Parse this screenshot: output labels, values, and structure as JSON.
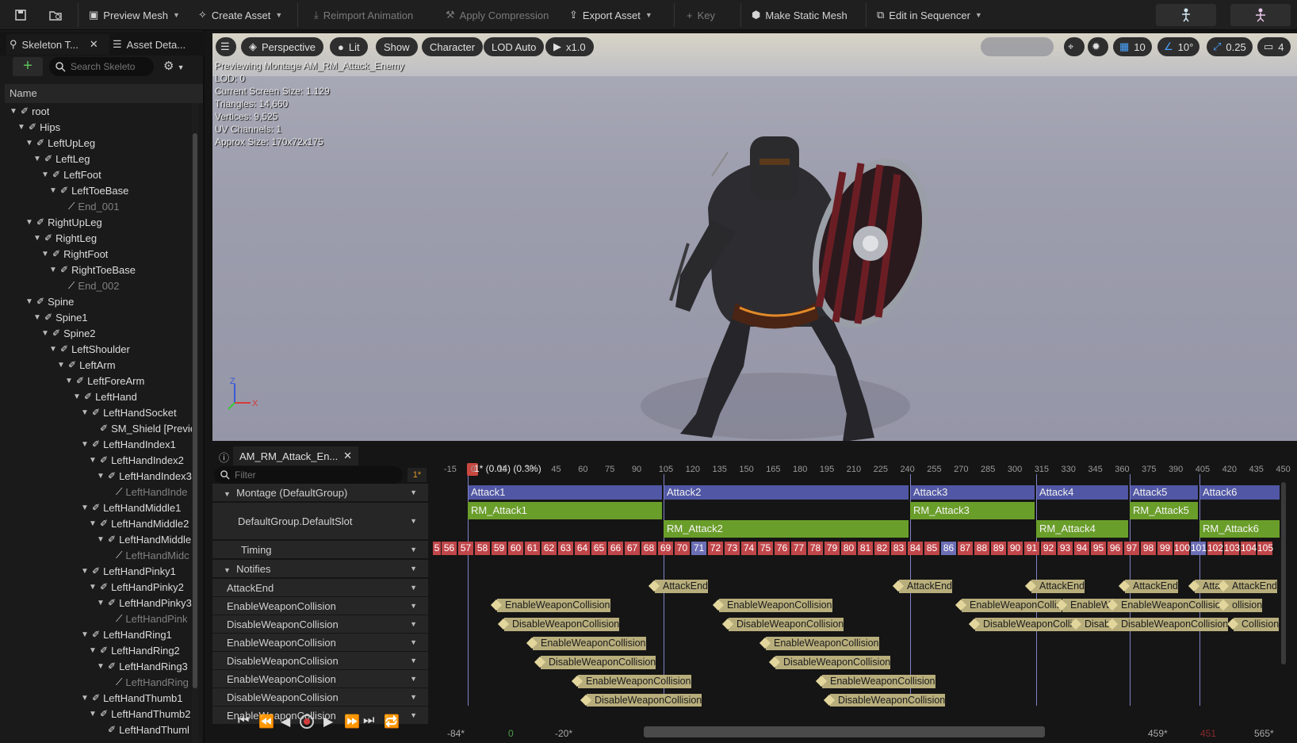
{
  "toolbar": {
    "preview_mesh": "Preview Mesh",
    "create_asset": "Create Asset",
    "reimport": "Reimport Animation",
    "apply_compression": "Apply Compression",
    "export_asset": "Export Asset",
    "key": "Key",
    "make_static_mesh": "Make Static Mesh",
    "edit_in_sequencer": "Edit in Sequencer"
  },
  "left": {
    "tab_skeleton": "Skeleton T...",
    "tab_details": "Asset Deta...",
    "search_placeholder": "Search Skeleto",
    "name_header": "Name",
    "bones": [
      {
        "label": "root",
        "depth": 0,
        "dim": false
      },
      {
        "label": "Hips",
        "depth": 1,
        "dim": false
      },
      {
        "label": "LeftUpLeg",
        "depth": 2,
        "dim": false
      },
      {
        "label": "LeftLeg",
        "depth": 3,
        "dim": false
      },
      {
        "label": "LeftFoot",
        "depth": 4,
        "dim": false
      },
      {
        "label": "LeftToeBase",
        "depth": 5,
        "dim": false
      },
      {
        "label": "End_001",
        "depth": 6,
        "dim": true
      },
      {
        "label": "RightUpLeg",
        "depth": 2,
        "dim": false
      },
      {
        "label": "RightLeg",
        "depth": 3,
        "dim": false
      },
      {
        "label": "RightFoot",
        "depth": 4,
        "dim": false
      },
      {
        "label": "RightToeBase",
        "depth": 5,
        "dim": false
      },
      {
        "label": "End_002",
        "depth": 6,
        "dim": true
      },
      {
        "label": "Spine",
        "depth": 2,
        "dim": false
      },
      {
        "label": "Spine1",
        "depth": 3,
        "dim": false
      },
      {
        "label": "Spine2",
        "depth": 4,
        "dim": false
      },
      {
        "label": "LeftShoulder",
        "depth": 5,
        "dim": false
      },
      {
        "label": "LeftArm",
        "depth": 6,
        "dim": false
      },
      {
        "label": "LeftForeArm",
        "depth": 7,
        "dim": false
      },
      {
        "label": "LeftHand",
        "depth": 8,
        "dim": false
      },
      {
        "label": "LeftHandSocket",
        "depth": 9,
        "dim": false
      },
      {
        "label": "SM_Shield [Previe",
        "depth": 10,
        "dim": false
      },
      {
        "label": "LeftHandIndex1",
        "depth": 9,
        "dim": false
      },
      {
        "label": "LeftHandIndex2",
        "depth": 10,
        "dim": false
      },
      {
        "label": "LeftHandIndex3",
        "depth": 11,
        "dim": false
      },
      {
        "label": "LeftHandInde",
        "depth": 12,
        "dim": true
      },
      {
        "label": "LeftHandMiddle1",
        "depth": 9,
        "dim": false
      },
      {
        "label": "LeftHandMiddle2",
        "depth": 10,
        "dim": false
      },
      {
        "label": "LeftHandMiddle",
        "depth": 11,
        "dim": false
      },
      {
        "label": "LeftHandMidc",
        "depth": 12,
        "dim": true
      },
      {
        "label": "LeftHandPinky1",
        "depth": 9,
        "dim": false
      },
      {
        "label": "LeftHandPinky2",
        "depth": 10,
        "dim": false
      },
      {
        "label": "LeftHandPinky3",
        "depth": 11,
        "dim": false
      },
      {
        "label": "LeftHandPink",
        "depth": 12,
        "dim": true
      },
      {
        "label": "LeftHandRing1",
        "depth": 9,
        "dim": false
      },
      {
        "label": "LeftHandRing2",
        "depth": 10,
        "dim": false
      },
      {
        "label": "LeftHandRing3",
        "depth": 11,
        "dim": false
      },
      {
        "label": "LeftHandRing",
        "depth": 12,
        "dim": true
      },
      {
        "label": "LeftHandThumb1",
        "depth": 9,
        "dim": false
      },
      {
        "label": "LeftHandThumb2",
        "depth": 10,
        "dim": false
      },
      {
        "label": "LeftHandThuml",
        "depth": 11,
        "dim": false
      }
    ]
  },
  "viewport": {
    "perspective": "Perspective",
    "lit": "Lit",
    "show": "Show",
    "character": "Character",
    "lod": "LOD Auto",
    "speed": "x1.0",
    "grid_snap": "10",
    "rot_snap": "10°",
    "scale_snap": "0.25",
    "cam_speed": "4",
    "stats": [
      "Previewing Montage AM_RM_Attack_Enemy",
      "LOD: 0",
      "Current Screen Size: 1.129",
      "Triangles: 14,660",
      "Vertices: 9,525",
      "UV Channels: 1",
      "Approx Size: 170x72x175"
    ]
  },
  "montage": {
    "tab_title": "AM_RM_Attack_En...",
    "filter_placeholder": "Filter",
    "filter_count": "1*",
    "playhead": "1* (0.04) (0.3%)",
    "montage_group": "Montage (DefaultGroup)",
    "slot": "DefaultGroup.DefaultSlot",
    "timing": "Timing",
    "notifies": "Notifies",
    "notify_tracks": [
      "AttackEnd",
      "EnableWeaponCollision",
      "DisableWeaponCollision",
      "EnableWeaponCollision",
      "DisableWeaponCollision",
      "EnableWeaponCollision",
      "DisableWeaponCollision",
      "EnableWeaponCollision"
    ],
    "ruler": [
      "-15",
      "0",
      "15",
      "30",
      "45",
      "60",
      "75",
      "90",
      "105",
      "120",
      "135",
      "150",
      "165",
      "180",
      "195",
      "210",
      "225",
      "240",
      "255",
      "270",
      "285",
      "300",
      "315",
      "330",
      "345",
      "360",
      "375",
      "390",
      "405",
      "420",
      "435",
      "450"
    ],
    "sections": [
      "Attack1",
      "Attack2",
      "Attack3",
      "Attack4",
      "Attack5",
      "Attack6"
    ],
    "slots_top": [
      "RM_Attack1",
      "RM_Attack3",
      "RM_Attack5"
    ],
    "slots_bottom": [
      "RM_Attack2",
      "RM_Attack4",
      "RM_Attack6"
    ],
    "timing_start": "5",
    "timing_frames": [
      "56",
      "57",
      "58",
      "59",
      "60",
      "61",
      "62",
      "63",
      "64",
      "65",
      "66",
      "67",
      "68",
      "69",
      "70",
      "71",
      "72",
      "73",
      "74",
      "75",
      "76",
      "77",
      "78",
      "79",
      "80",
      "81",
      "82",
      "83",
      "84",
      "85",
      "86",
      "87",
      "88",
      "89",
      "90",
      "91",
      "92",
      "93",
      "94",
      "95",
      "96",
      "97",
      "98",
      "99",
      "100",
      "101",
      "102",
      "103",
      "104",
      "105"
    ],
    "notify_attack_end": "AttackEnd",
    "notify_attac": "Attac",
    "notify_enable": "EnableWeaponCollision",
    "notify_disable": "DisableWeaponCollision",
    "notify_enable_cut": "EnableWeaponCollis",
    "notify_enable_cut2": "EnableWea",
    "notify_disable_cut": "DisableWeaponCollisi",
    "notify_disable_cut2": "Disable",
    "notify_collision": "Collision",
    "notify_ollision": "ollision",
    "range_left": "-84*",
    "range_start": "0",
    "range_neg20": "-20*",
    "range_459": "459*",
    "range_451": "451",
    "range_565": "565*"
  },
  "colors": {
    "section": "#5157a4",
    "slot": "#6a9e2a",
    "frame": "#c0464a",
    "frame_alt": "#6d6fb6",
    "notify": "#b8ae7c"
  }
}
